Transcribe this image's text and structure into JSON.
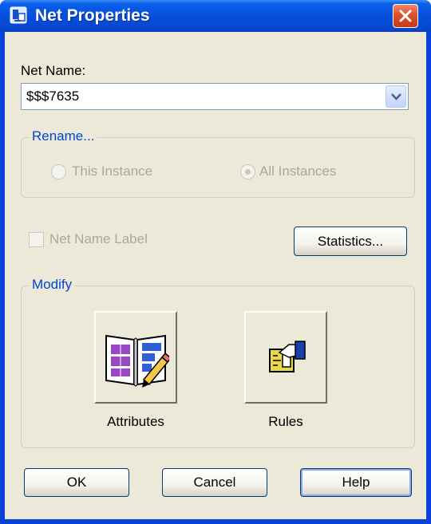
{
  "window": {
    "title": "Net Properties"
  },
  "net_name": {
    "label": "Net Name:",
    "value": "$$$7635"
  },
  "rename": {
    "title": "Rename...",
    "options": [
      {
        "label": "This Instance",
        "selected": false,
        "enabled": false
      },
      {
        "label": "All Instances",
        "selected": true,
        "enabled": false
      }
    ]
  },
  "net_name_label": {
    "label": "Net Name Label",
    "checked": false,
    "enabled": false
  },
  "statistics_button": "Statistics...",
  "modify": {
    "title": "Modify",
    "attributes_label": "Attributes",
    "rules_label": "Rules"
  },
  "footer": {
    "ok": "OK",
    "cancel": "Cancel",
    "help": "Help"
  },
  "colors": {
    "title_bar": "#0550dd",
    "close_button": "#e0502a",
    "dialog_face": "#ece9d8",
    "group_title": "#0046d5",
    "disabled_text": "#aca899"
  },
  "icons": {
    "title": "app-icon",
    "close": "close-icon",
    "dropdown": "chevron-down-icon",
    "attributes": "book-pencil-icon",
    "rules": "hand-ruler-icon"
  }
}
